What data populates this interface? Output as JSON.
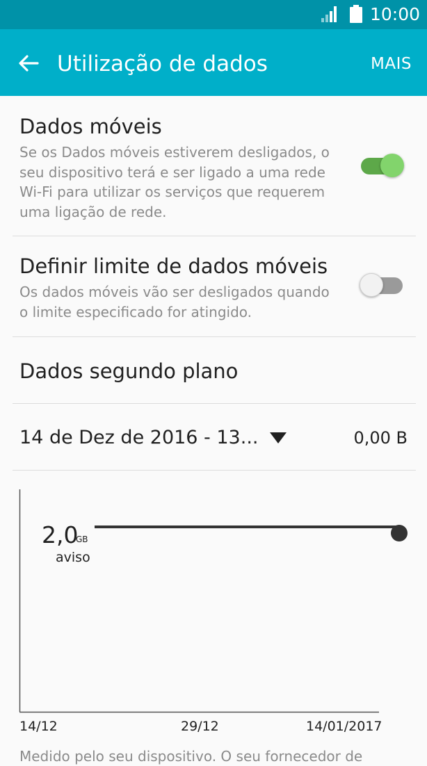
{
  "status_bar": {
    "time": "10:00",
    "icons": [
      "signal-icon",
      "battery-icon"
    ],
    "background_color": "#0092a8"
  },
  "app_bar": {
    "title": "Utilização de dados",
    "more_label": "MAIS",
    "back_icon": "back-arrow-icon",
    "background_color": "#00afc9"
  },
  "settings": {
    "mobile_data": {
      "title": "Dados móveis",
      "description": "Se os Dados móveis estiverem desligados, o seu dispositivo terá e ser ligado a uma rede Wi-Fi para utilizar os serviços que requerem uma ligação de rede.",
      "enabled": true
    },
    "data_limit": {
      "title": "Definir limite de dados móveis",
      "description": "Os dados móveis vão ser desligados quando o limite especificado for atingido.",
      "enabled": false
    },
    "background_data": {
      "title": "Dados segundo plano"
    }
  },
  "usage_cycle": {
    "selected_range": "14 de Dez de 2016 - 13...",
    "total_usage": "0,00 B"
  },
  "chart": {
    "warning_value": "2,0",
    "warning_unit": "GB",
    "warning_label": "aviso",
    "x_labels": [
      "14/12",
      "29/12",
      "14/01/2017"
    ],
    "toggle_on_color": "#5da849",
    "toggle_off_color": "#9a9a9a"
  },
  "footer": {
    "text": "Medido pelo seu dispositivo. O seu fornecedor de"
  }
}
